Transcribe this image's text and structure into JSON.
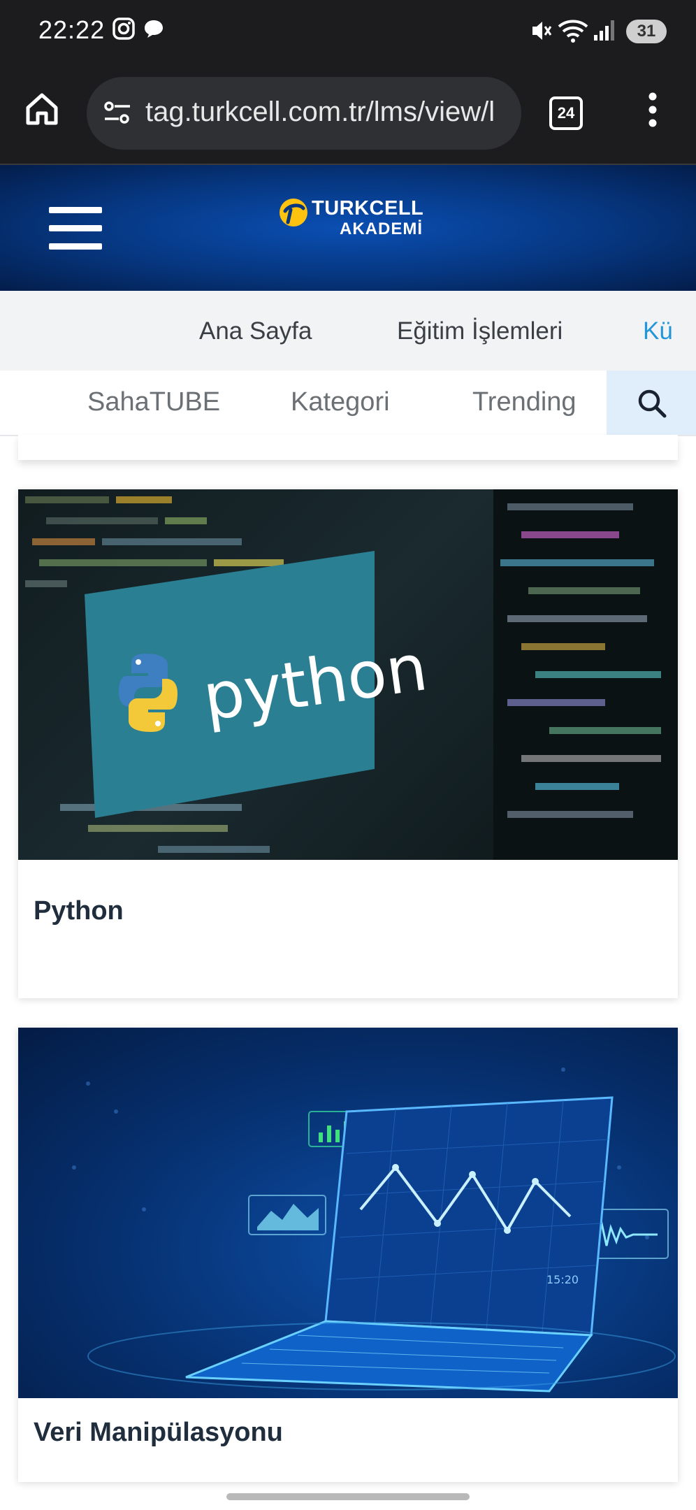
{
  "status_bar": {
    "time": "22:22",
    "battery": "31",
    "icons": [
      "instagram-icon",
      "chat-bubble-icon",
      "mute-icon",
      "wifi-icon",
      "signal-icon"
    ]
  },
  "browser": {
    "url": "tag.turkcell.com.tr/lms/view/l",
    "tab_count": "24"
  },
  "header": {
    "logo_main": "TURKCELL",
    "logo_sub": "AKADEMİ",
    "brand_colors": {
      "header_blue": "#06367f",
      "logo_yellow": "#ffc20e"
    }
  },
  "nav_primary": [
    {
      "label": "Ana Sayfa"
    },
    {
      "label": "Eğitim İşlemleri"
    },
    {
      "label": "Kü"
    }
  ],
  "nav_secondary": [
    {
      "label": "SahaTUBE"
    },
    {
      "label": "Kategori"
    },
    {
      "label": "Trending"
    }
  ],
  "cards": [
    {
      "title": "Python",
      "image_text": "python"
    },
    {
      "title": "Veri Manipülasyonu",
      "image_text": "15:20"
    }
  ],
  "accent_colors": {
    "active_link": "#2196d9",
    "search_bg": "#e0eefc"
  }
}
